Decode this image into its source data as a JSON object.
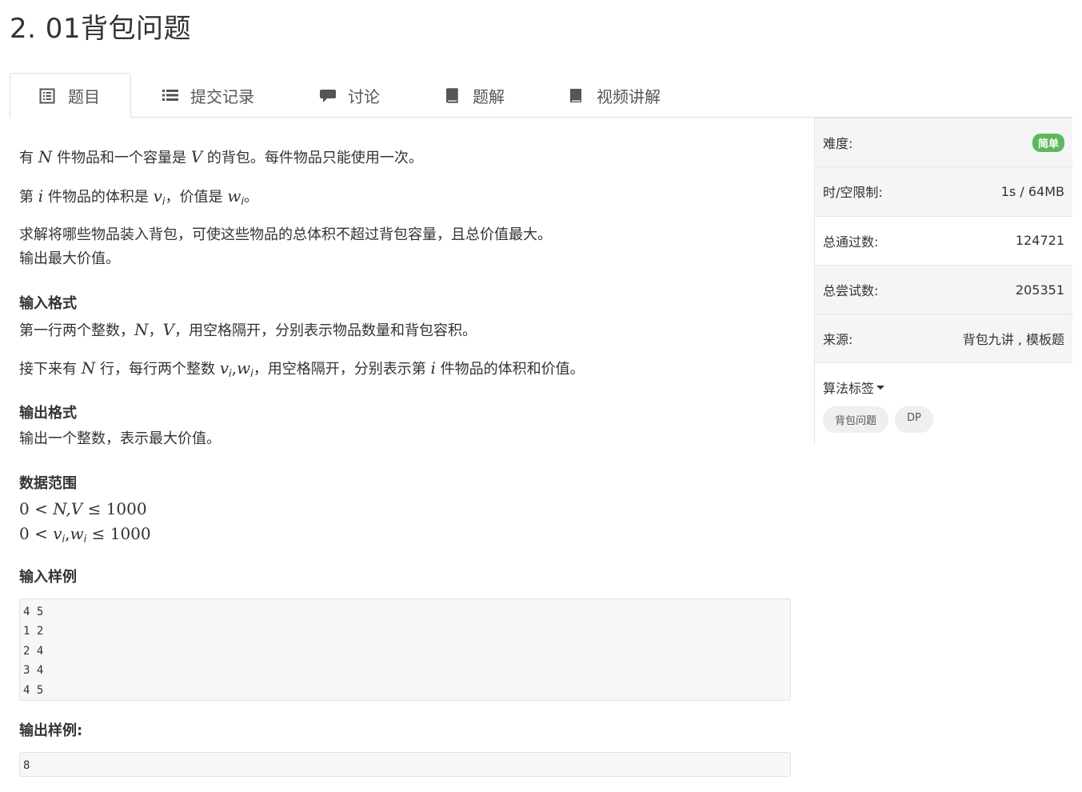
{
  "title": "2. 01背包问题",
  "tabs": [
    {
      "label": "题目",
      "icon": "list-alt-icon"
    },
    {
      "label": "提交记录",
      "icon": "list-icon"
    },
    {
      "label": "讨论",
      "icon": "comment-icon"
    },
    {
      "label": "题解",
      "icon": "book-icon"
    },
    {
      "label": "视频讲解",
      "icon": "book-icon"
    }
  ],
  "problem": {
    "p1_a": "有 ",
    "p1_N": "N",
    "p1_b": " 件物品和一个容量是 ",
    "p1_V": "V",
    "p1_c": " 的背包。每件物品只能使用一次。",
    "p2_a": "第 ",
    "p2_i": "i",
    "p2_b": " 件物品的体积是 ",
    "p2_v": "v",
    "p2_vs": "i",
    "p2_c": "，价值是 ",
    "p2_w": "w",
    "p2_ws": "i",
    "p2_d": "。",
    "p3": "求解将哪些物品装入背包，可使这些物品的总体积不超过背包容量，且总价值最大。",
    "p4": "输出最大价值。",
    "input_heading": "输入格式",
    "in1_a": "第一行两个整数，",
    "in1_N": "N",
    "in1_sep": "，",
    "in1_V": "V",
    "in1_b": "，用空格隔开，分别表示物品数量和背包容积。",
    "in2_a": "接下来有 ",
    "in2_N": "N",
    "in2_b": " 行，每行两个整数 ",
    "in2_v": "v",
    "in2_vs": "i",
    "in2_comma": ",",
    "in2_w": "w",
    "in2_ws": "i",
    "in2_c": "，用空格隔开，分别表示第 ",
    "in2_i": "i",
    "in2_d": " 件物品的体积和价值。",
    "output_heading": "输出格式",
    "out1": "输出一个整数，表示最大价值。",
    "range_heading": "数据范围",
    "r1_a": "0 < ",
    "r1_b": "N,V",
    "r1_c": " ≤ 1000",
    "r2_a": "0 < ",
    "r2_v": "v",
    "r2_vs": "i",
    "r2_comma": ",",
    "r2_w": "w",
    "r2_ws": "i",
    "r2_c": " ≤ 1000",
    "sample_in_heading": "输入样例",
    "sample_in": [
      "4 5",
      "1 2",
      "2 4",
      "3 4",
      "4 5"
    ],
    "sample_out_heading": "输出样例:",
    "sample_out": [
      "8"
    ]
  },
  "sidebar": {
    "difficulty_label": "难度:",
    "difficulty_value": "简单",
    "limit_label": "时/空限制:",
    "limit_value": "1s / 64MB",
    "passed_label": "总通过数:",
    "passed_value": "124721",
    "tried_label": "总尝试数:",
    "tried_value": "205351",
    "source_label": "来源:",
    "source_value": "背包九讲 , 模板题",
    "tags_label": "算法标签",
    "tags": [
      "背包问题",
      "DP"
    ]
  },
  "colors": {
    "easy_badge": "#5cb85c",
    "border": "#dddddd",
    "code_bg": "#f7f7f9"
  }
}
